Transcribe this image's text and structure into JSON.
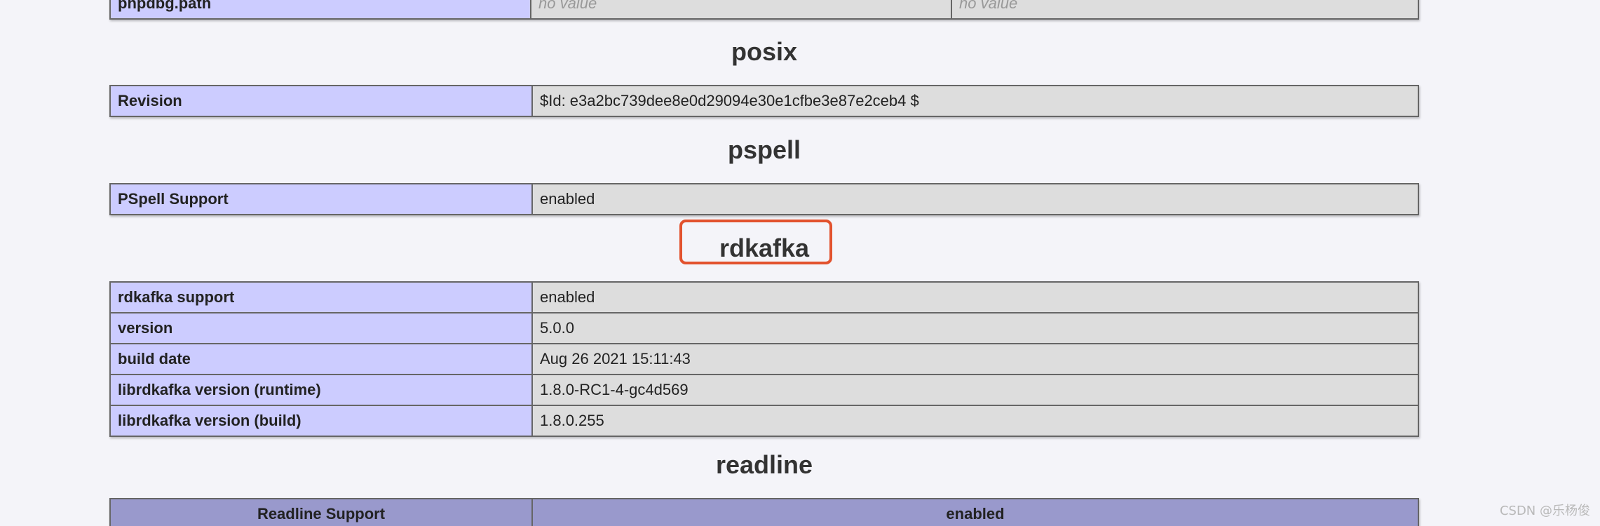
{
  "sections": {
    "phpdbg_row": {
      "label": "phpdbg.path",
      "local": "no value",
      "master": "no value"
    },
    "posix": {
      "title": "posix",
      "rows": [
        {
          "label": "Revision",
          "value": "$Id: e3a2bc739dee8e0d29094e30e1cfbe3e87e2ceb4 $"
        }
      ]
    },
    "pspell": {
      "title": "pspell",
      "rows": [
        {
          "label": "PSpell Support",
          "value": "enabled"
        }
      ]
    },
    "rdkafka": {
      "title": "rdkafka",
      "rows": [
        {
          "label": "rdkafka support",
          "value": "enabled"
        },
        {
          "label": "version",
          "value": "5.0.0"
        },
        {
          "label": "build date",
          "value": "Aug 26 2021 15:11:43"
        },
        {
          "label": "librdkafka version (runtime)",
          "value": "1.8.0-RC1-4-gc4d569"
        },
        {
          "label": "librdkafka version (build)",
          "value": "1.8.0.255"
        }
      ]
    },
    "readline": {
      "title": "readline",
      "header": {
        "label": "Readline Support",
        "value": "enabled"
      }
    }
  },
  "watermark": "CSDN @乐杨俊",
  "colors": {
    "page_bg": "#f4f4f9",
    "label_bg": "#ccccff",
    "value_bg": "#dddddd",
    "header_bg": "#9999cc",
    "highlight": "#e2522e"
  }
}
